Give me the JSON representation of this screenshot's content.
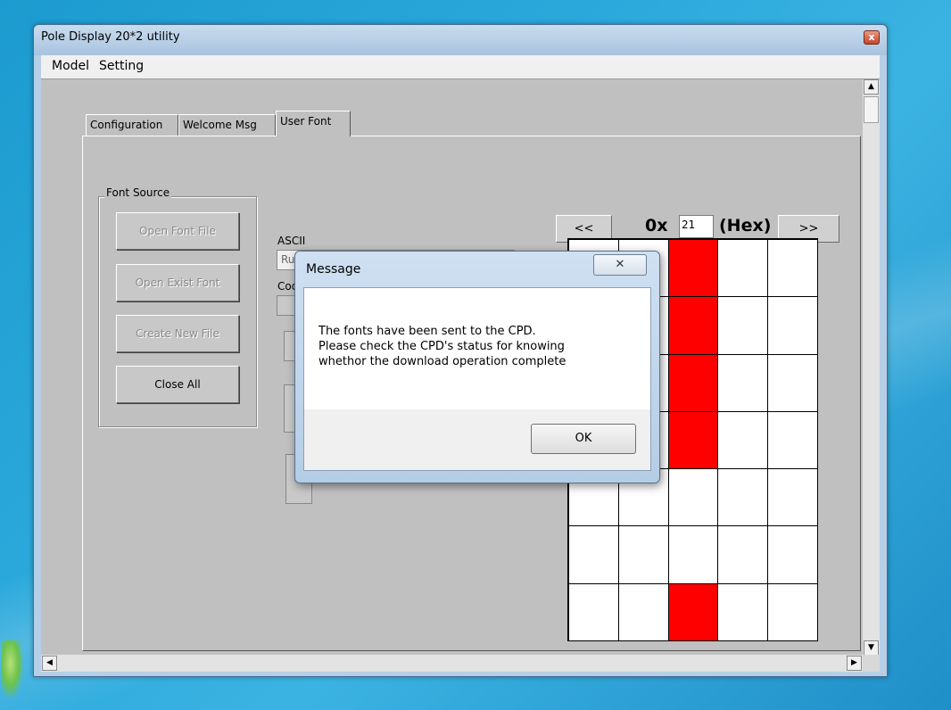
{
  "window": {
    "title": "Pole Display 20*2 utility",
    "close_glyph": "x"
  },
  "menu": [
    "Model",
    "Setting"
  ],
  "tabs": [
    "Configuration",
    "Welcome Msg",
    "User Font"
  ],
  "active_tab": "User Font",
  "font_source": {
    "legend": "Font Source",
    "buttons": [
      {
        "label": "Open Font File",
        "enabled": false
      },
      {
        "label": "Open Exist Font",
        "enabled": false
      },
      {
        "label": "Create New File",
        "enabled": false
      },
      {
        "label": "Close All",
        "enabled": true
      }
    ]
  },
  "ascii": {
    "label": "ASCII",
    "value": "Russia"
  },
  "code_page": {
    "label": "Code page"
  },
  "char_nav": {
    "prev": "<<",
    "next": ">>",
    "prefix": "0x",
    "value": "21",
    "suffix": "(Hex)"
  },
  "glyph_grid": {
    "cols": 5,
    "rows": 7,
    "on_color": "#FF0000",
    "off_color": "#FFFFFF",
    "pixels": [
      [
        0,
        0,
        1,
        0,
        0
      ],
      [
        0,
        0,
        1,
        0,
        0
      ],
      [
        0,
        0,
        1,
        0,
        0
      ],
      [
        0,
        0,
        1,
        0,
        0
      ],
      [
        0,
        0,
        0,
        0,
        0
      ],
      [
        0,
        0,
        0,
        0,
        0
      ],
      [
        0,
        0,
        1,
        0,
        0
      ]
    ]
  },
  "dialog": {
    "title": "Message",
    "lines": [
      "The fonts have been sent to the CPD.",
      "Please check the CPD's status for knowing",
      "whethor the download operation complete"
    ],
    "ok": "OK"
  }
}
